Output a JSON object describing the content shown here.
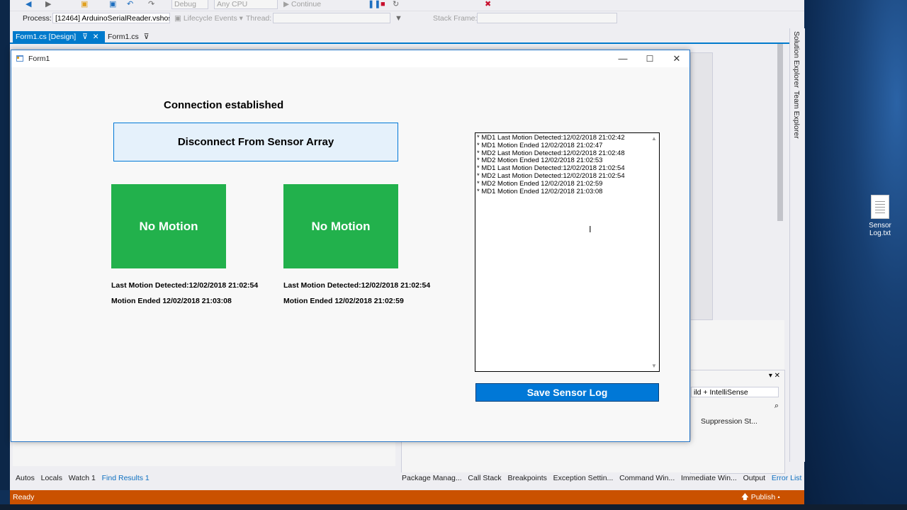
{
  "vs": {
    "toolbar": {
      "config": "Debug",
      "platform": "Any CPU",
      "continue_label": "Continue",
      "process_label": "Process:",
      "process_value": "[12464] ArduinoSerialReader.vshos",
      "lifecycle_label": "Lifecycle Events",
      "thread_label": "Thread:",
      "stack_frame_label": "Stack Frame:"
    },
    "doc_tabs": [
      {
        "label": "Form1.cs [Design]",
        "active": true
      },
      {
        "label": "Form1.cs",
        "active": false
      }
    ],
    "side_tabs": [
      "Solution Explorer",
      "Team Explorer"
    ],
    "error_panel": {
      "build_filter": "ild + IntelliSense",
      "suppression_col": "Suppression St..."
    },
    "bottom_left_tabs": [
      "Autos",
      "Locals",
      "Watch 1",
      "Find Results 1"
    ],
    "bottom_right_tabs": [
      "Package Manag...",
      "Call Stack",
      "Breakpoints",
      "Exception Settin...",
      "Command Win...",
      "Immediate Win...",
      "Output",
      "Error List"
    ],
    "status": {
      "text": "Ready",
      "publish": "Publish"
    }
  },
  "form": {
    "title": "Form1",
    "connection_status": "Connection established",
    "disconnect_button": "Disconnect From Sensor Array",
    "sensors": [
      {
        "status": "No Motion",
        "last_detected": "Last Motion Detected:12/02/2018 21:02:54",
        "ended": "Motion Ended 12/02/2018 21:03:08"
      },
      {
        "status": "No Motion",
        "last_detected": "Last Motion Detected:12/02/2018 21:02:54",
        "ended": "Motion Ended 12/02/2018 21:02:59"
      }
    ],
    "log": [
      "* MD1 Last Motion Detected:12/02/2018 21:02:42",
      "* MD1 Motion Ended 12/02/2018 21:02:47",
      "* MD2 Last Motion Detected:12/02/2018 21:02:48",
      "* MD2 Motion Ended 12/02/2018 21:02:53",
      "* MD1 Last Motion Detected:12/02/2018 21:02:54",
      "* MD2 Last Motion Detected:12/02/2018 21:02:54",
      "* MD2 Motion Ended 12/02/2018 21:02:59",
      "* MD1 Motion Ended 12/02/2018 21:03:08"
    ],
    "save_button": "Save Sensor Log"
  },
  "desktop": {
    "file_label": "Sensor Log.txt"
  },
  "colors": {
    "status_bar": "#ca5100",
    "motion_idle": "#22b14c",
    "accent": "#0078d7"
  }
}
